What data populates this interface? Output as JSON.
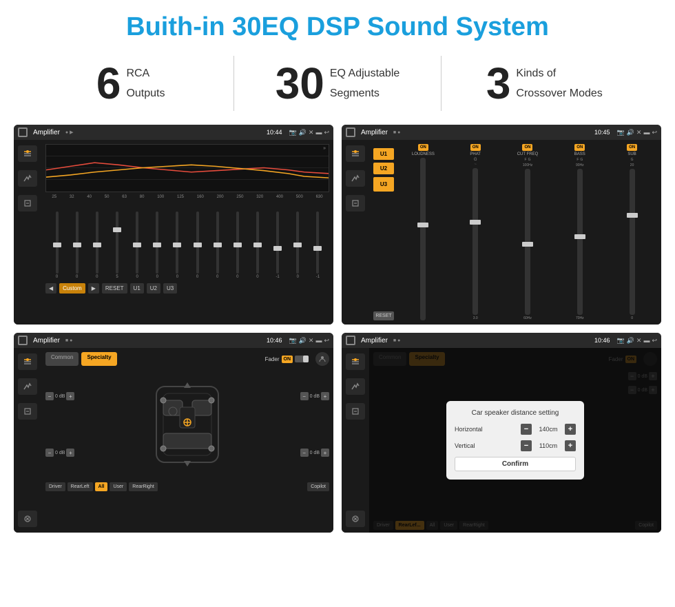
{
  "page": {
    "title": "Buith-in 30EQ DSP Sound System"
  },
  "stats": [
    {
      "number": "6",
      "label_line1": "RCA",
      "label_line2": "Outputs"
    },
    {
      "number": "30",
      "label_line1": "EQ Adjustable",
      "label_line2": "Segments"
    },
    {
      "number": "3",
      "label_line1": "Kinds of",
      "label_line2": "Crossover Modes"
    }
  ],
  "screens": [
    {
      "id": "eq-screen",
      "title": "Amplifier",
      "time": "10:44",
      "type": "equalizer",
      "eq_labels": [
        "25",
        "32",
        "40",
        "50",
        "63",
        "80",
        "100",
        "125",
        "160",
        "200",
        "250",
        "320",
        "400",
        "500",
        "630"
      ],
      "eq_values": [
        "0",
        "0",
        "0",
        "5",
        "0",
        "0",
        "0",
        "0",
        "0",
        "0",
        "0",
        "-1",
        "0",
        "-1"
      ],
      "preset_label": "Custom",
      "buttons": [
        "RESET",
        "U1",
        "U2",
        "U3"
      ]
    },
    {
      "id": "amp-screen",
      "title": "Amplifier",
      "time": "10:45",
      "type": "amplifier",
      "presets": [
        "U1",
        "U2",
        "U3"
      ],
      "channels": [
        {
          "toggle": "ON",
          "name": "LOUDNESS"
        },
        {
          "toggle": "ON",
          "name": "PHAT"
        },
        {
          "toggle": "ON",
          "name": "CUT FREQ"
        },
        {
          "toggle": "ON",
          "name": "BASS"
        },
        {
          "toggle": "ON",
          "name": "SUB"
        }
      ],
      "reset_label": "RESET"
    },
    {
      "id": "speaker-screen",
      "title": "Amplifier",
      "time": "10:46",
      "type": "speaker",
      "tabs": [
        "Common",
        "Specialty"
      ],
      "active_tab": "Specialty",
      "fader_label": "Fader",
      "fader_on": "ON",
      "positions": [
        {
          "label": "0 dB"
        },
        {
          "label": "0 dB"
        },
        {
          "label": "0 dB"
        },
        {
          "label": "0 dB"
        }
      ],
      "bottom_buttons": [
        "Driver",
        "RearLeft",
        "All",
        "User",
        "RearRight",
        "Copilot"
      ]
    },
    {
      "id": "dialog-screen",
      "title": "Amplifier",
      "time": "10:46",
      "type": "speaker-dialog",
      "tabs": [
        "Common",
        "Specialty"
      ],
      "active_tab": "Specialty",
      "dialog": {
        "title": "Car speaker distance setting",
        "fields": [
          {
            "label": "Horizontal",
            "value": "140cm"
          },
          {
            "label": "Vertical",
            "value": "110cm"
          }
        ],
        "confirm_label": "Confirm"
      },
      "bottom_buttons": [
        "Driver",
        "RearLef...",
        "All",
        "User",
        "RearRight",
        "Copilot"
      ]
    }
  ]
}
